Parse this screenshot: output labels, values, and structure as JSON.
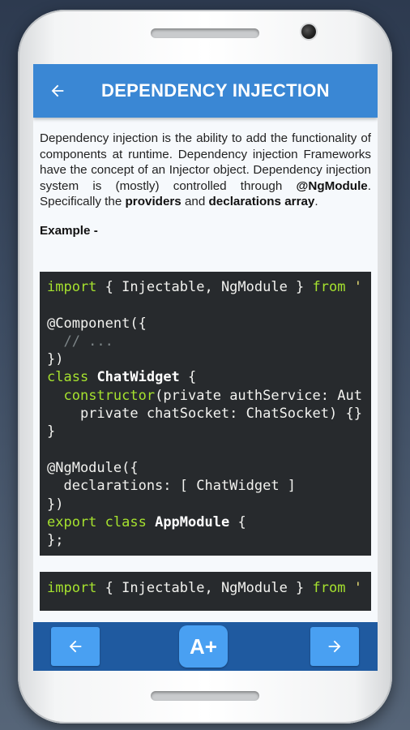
{
  "header": {
    "title": "DEPENDENCY INJECTION",
    "back_icon": "arrow-left-icon"
  },
  "article": {
    "paragraph_part1": "Dependency injection is the ability to add the functionality of components at runtime. Dependency injection Frameworks have the concept of an Injector object. Dependency injection system is (mostly) controlled through ",
    "ngmodule_bold": "@NgModule",
    "paragraph_part2": ". Specifically the ",
    "providers_bold": "providers",
    "paragraph_part3": " and ",
    "declarations_bold": "declarations array",
    "paragraph_part4": ".",
    "example_label": "Example -"
  },
  "code_block_1": {
    "l1_kw": "import",
    "l1_rest": " { Injectable, NgModule } ",
    "l1_from": "from",
    "l1_str": " '",
    "l3": "@Component({",
    "l4": "  // ...",
    "l5": "})",
    "l6_kw": "class",
    "l6_name": "ChatWidget",
    "l6_rest": " {",
    "l7_kw": "constructor",
    "l7_rest": "(private authService: Aut",
    "l8": "    private chatSocket: ChatSocket) {}",
    "l9": "}",
    "l11": "@NgModule({",
    "l12": "  declarations: [ ChatWidget ]",
    "l13": "})",
    "l14_kw": "export class",
    "l14_name": "AppModule",
    "l14_rest": " {",
    "l15": "};"
  },
  "code_block_2": {
    "l1_kw": "import",
    "l1_rest": " { Injectable, NgModule } ",
    "l1_from": "from",
    "l1_str": " '"
  },
  "bottom_bar": {
    "prev_icon": "arrow-left-icon",
    "font_size_label": "A+",
    "next_icon": "arrow-right-icon"
  },
  "colors": {
    "appbar": "#3a87d4",
    "bottombar": "#1f5aa0",
    "button": "#49a0f2",
    "code_bg": "#272a2d",
    "code_keyword": "#a6e22e"
  }
}
